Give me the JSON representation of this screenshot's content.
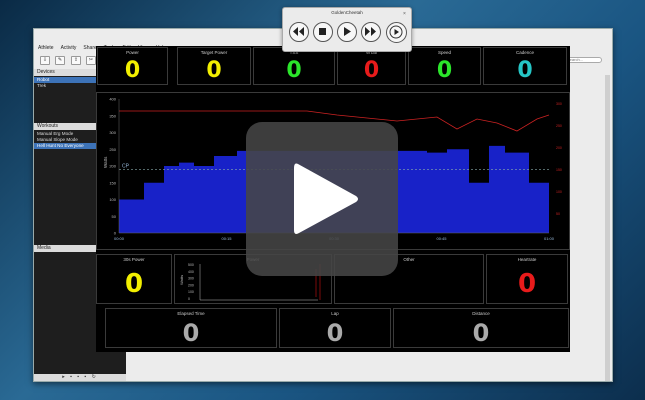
{
  "transport": {
    "title": "GoldenCheetah"
  },
  "menu": [
    "Athlete",
    "Activity",
    "Share",
    "Tools",
    "Edit",
    "View",
    "Help"
  ],
  "view_tabs": [
    {
      "label": "Trends",
      "active": false
    },
    {
      "label": "Diary",
      "active": false
    },
    {
      "label": "Activities",
      "active": false
    },
    {
      "label": "Train",
      "active": true
    }
  ],
  "search_placeholder": "Search...",
  "sidebar": {
    "devices_header": "Devices",
    "devices": [
      {
        "label": "Robot",
        "selected": true
      },
      {
        "label": "Trek",
        "selected": false
      }
    ],
    "workouts_header": "Workouts",
    "workouts": [
      {
        "label": "Manual Erg Mode",
        "selected": false
      },
      {
        "label": "Manual Slope Mode",
        "selected": false
      },
      {
        "label": "Hell Hunt No Everyone",
        "selected": true
      }
    ],
    "media_header": "Media",
    "menu_glyph": "≡",
    "footer_icons": "▸ ▪ ▪ ▪ ↻"
  },
  "top_tiles": [
    {
      "label": "Power",
      "value": "0",
      "color": "#f2ef00"
    },
    {
      "label": "Target Power",
      "value": "0",
      "color": "#f2ef00"
    },
    {
      "label": "TSS",
      "value": "0",
      "color": "#2be62b"
    },
    {
      "label": "W'bal",
      "value": "0",
      "color": "#e81b1b"
    },
    {
      "label": "Speed",
      "value": "0",
      "color": "#2be62b"
    },
    {
      "label": "Cadence",
      "value": "0",
      "color": "#25c6c6"
    }
  ],
  "mid_tiles": [
    {
      "label": "30s Power",
      "value": "0",
      "color": "#f2ef00"
    },
    {
      "label": "Power",
      "value": "",
      "color": "#fff"
    },
    {
      "label": "Other",
      "value": "",
      "color": "#fff"
    },
    {
      "label": "Heartrate",
      "value": "0",
      "color": "#e81b1b"
    }
  ],
  "bottom_tiles": [
    {
      "label": "Elapsed Time",
      "value": "0",
      "color": "#aaaaaa"
    },
    {
      "label": "Lap",
      "value": "0",
      "color": "#aaaaaa"
    },
    {
      "label": "Distance",
      "value": "0",
      "color": "#aaaaaa"
    }
  ],
  "workout_chart": {
    "ylabel": "Watts",
    "cp_label": "CP",
    "cp_value": 190,
    "ylim": [
      0,
      400
    ],
    "yticks": [
      "400",
      "350",
      "300",
      "250",
      "200",
      "150",
      "100",
      "50",
      "0"
    ],
    "xticks": [
      "00:00",
      "00:15",
      "00:30",
      "00:45",
      "01:00"
    ],
    "right_ticks": [
      "300",
      "250",
      "200",
      "150",
      "100",
      "50"
    ]
  },
  "small_chart": {
    "ylabel": "Watts",
    "yticks": [
      "500",
      "400",
      "300",
      "200",
      "100",
      "0"
    ]
  }
}
